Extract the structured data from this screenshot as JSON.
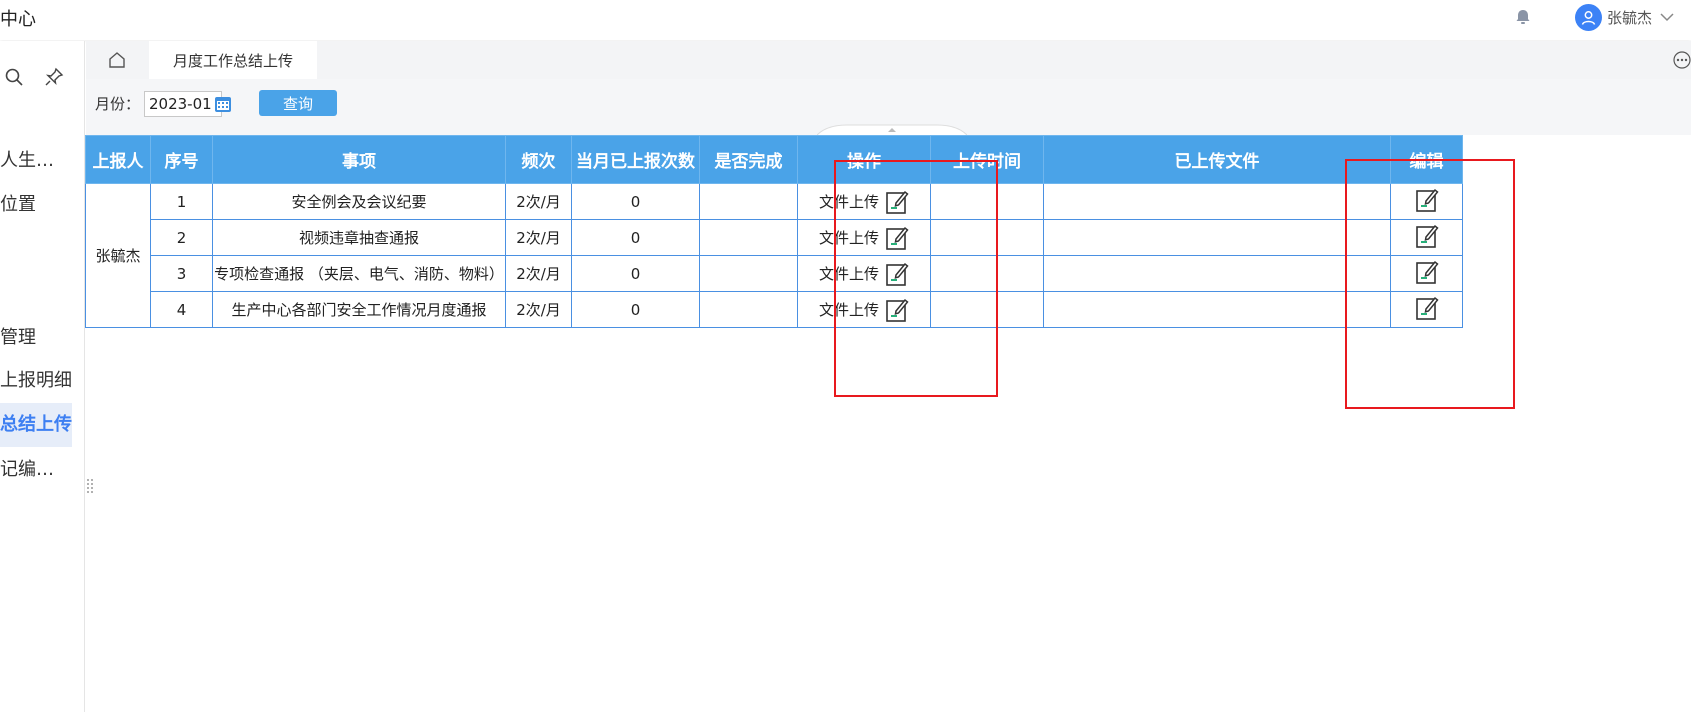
{
  "header": {
    "app_title": "中心",
    "user_name": "张毓杰",
    "icons": [
      "bell-icon",
      "user-avatar-icon",
      "chevron-down-icon"
    ]
  },
  "sidebar": {
    "tools": [
      "search-icon",
      "pin-icon"
    ],
    "items": [
      {
        "label": "人生…"
      },
      {
        "label": "位置"
      },
      {
        "label": "管理"
      },
      {
        "label": "上报明细"
      },
      {
        "label": "总结上传",
        "active": true
      },
      {
        "label": "记编…"
      }
    ]
  },
  "tabs": {
    "home_icon": "home-icon",
    "active_label": "月度工作总结上传",
    "more_icon": "more-icon"
  },
  "toolbar": {
    "month_label": "月份：",
    "month_value": "2023-01",
    "calendar_icon": "calendar-icon",
    "query_label": "查询"
  },
  "table": {
    "headers": [
      "上报人",
      "序号",
      "事项",
      "频次",
      "当月已上报次数",
      "是否完成",
      "操作",
      "上传时间",
      "已上传文件",
      "编辑"
    ],
    "reporter": "张毓杰",
    "rows": [
      {
        "no": "1",
        "item": "安全例会及会议纪要",
        "freq": "2次/月",
        "count": "0",
        "done": "",
        "op": "文件上传",
        "time": "",
        "files": ""
      },
      {
        "no": "2",
        "item": "视频违章抽查通报",
        "freq": "2次/月",
        "count": "0",
        "done": "",
        "op": "文件上传",
        "time": "",
        "files": ""
      },
      {
        "no": "3",
        "item": "专项检查通报 （夹层、电气、消防、物料）",
        "freq": "2次/月",
        "count": "0",
        "done": "",
        "op": "文件上传",
        "time": "",
        "files": ""
      },
      {
        "no": "4",
        "item": "生产中心各部门安全工作情况月度通报",
        "freq": "2次/月",
        "count": "0",
        "done": "",
        "op": "文件上传",
        "time": "",
        "files": ""
      }
    ]
  },
  "colors": {
    "header_blue": "#4aa3e8",
    "active_text": "#3d7ff2",
    "annotation_red": "#e8191e",
    "edit_icon_green": "#27b07a"
  }
}
